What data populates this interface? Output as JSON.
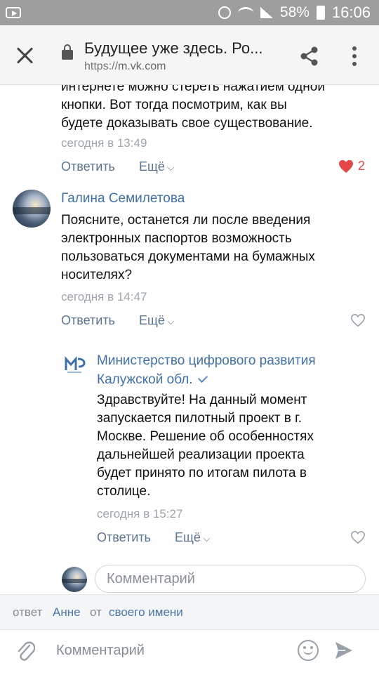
{
  "status_bar": {
    "battery": "58%",
    "time": "16:06"
  },
  "browser": {
    "title": "Будущее уже здесь. Ро...",
    "url_protocol": "https://",
    "url_host": "m.vk.com"
  },
  "comments": [
    {
      "text_lines": [
        "интернете можно стереть нажатием одной",
        "кнопки. Вот тогда посмотрим, как вы",
        "будете доказывать свое существование."
      ],
      "date": "сегодня в 13:49",
      "reply_label": "Ответить",
      "more_label": "Ещё",
      "likes": "2"
    },
    {
      "author": "Галина Семилетова",
      "text_lines": [
        "Поясните, останется ли после введения",
        "электронных паспортов возможность",
        "пользоваться документами на бумажных",
        "носителях?"
      ],
      "date": "сегодня в 14:47",
      "reply_label": "Ответить",
      "more_label": "Ещё"
    },
    {
      "author_line1": "Министерство цифрового развития",
      "author_line2": "Калужской обл.",
      "text_lines": [
        "Здравствуйте! На данный момент",
        "запускается пилотный проект в г.",
        "Москве. Решение об особенностях",
        "дальнейшей реализации проекта",
        "будет принято по итогам пилота в",
        "столице."
      ],
      "date": "сегодня в 15:27",
      "reply_label": "Ответить",
      "more_label": "Ещё"
    }
  ],
  "thread_input": {
    "placeholder": "Комментарий"
  },
  "reply_info": {
    "prefix": "ответ",
    "name": "Анне",
    "middle": "от",
    "identity": "своего имени"
  },
  "composer": {
    "placeholder": "Комментарий"
  },
  "colors": {
    "link": "#3f70a8",
    "like": "#e64646",
    "statusbar": "#9e9e9e"
  }
}
